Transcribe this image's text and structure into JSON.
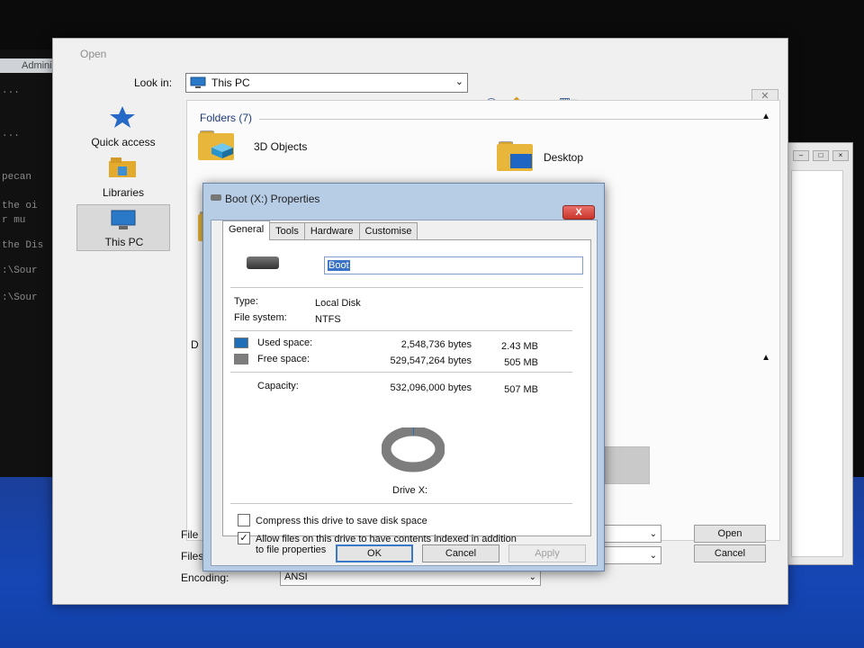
{
  "console": {
    "title": "Administ",
    "lines": [
      "...",
      "...",
      "",
      "pecan",
      "the oi",
      "r mu",
      "",
      "the Dis",
      ":\\Sour",
      "",
      ":\\Sour"
    ]
  },
  "open_dialog": {
    "title": "Open",
    "look_in_label": "Look in:",
    "look_in_value": "This PC",
    "places": [
      {
        "label": "Quick access",
        "icon": "star-icon"
      },
      {
        "label": "Libraries",
        "icon": "libraries-icon"
      },
      {
        "label": "This PC",
        "icon": "computer-icon",
        "selected": true
      }
    ],
    "folders_header": "Folders (7)",
    "folders": [
      {
        "label": "3D Objects"
      },
      {
        "label": "Desktop"
      }
    ],
    "devices_header_partial": "D",
    "file_name_label": "File",
    "files_type_label": "Files",
    "encoding_label": "Encoding:",
    "encoding_value": "ANSI",
    "open_button": "Open",
    "cancel_button": "Cancel"
  },
  "properties_dialog": {
    "title": "Boot (X:) Properties",
    "close_label": "X",
    "tabs": [
      "General",
      "Tools",
      "Hardware",
      "Customise"
    ],
    "active_tab": "General",
    "drive_name": "Boot",
    "type_label": "Type:",
    "type_value": "Local Disk",
    "fs_label": "File system:",
    "fs_value": "NTFS",
    "used_label": "Used space:",
    "used_bytes": "2,548,736 bytes",
    "used_size": "2.43 MB",
    "free_label": "Free space:",
    "free_bytes": "529,547,264 bytes",
    "free_size": "505 MB",
    "capacity_label": "Capacity:",
    "capacity_bytes": "532,096,000 bytes",
    "capacity_size": "507 MB",
    "used_fraction": 0.0048,
    "drive_caption": "Drive X:",
    "compress_label": "Compress this drive to save disk space",
    "compress_checked": false,
    "index_label_line1": "Allow files on this drive to have contents indexed in addition",
    "index_label_line2": "to file properties",
    "index_checked": true,
    "ok_button": "OK",
    "cancel_button": "Cancel",
    "apply_button": "Apply",
    "colors": {
      "used": "#1f6fb8",
      "free": "#7d7d7d",
      "titlebar": "#b7cde6",
      "close": "#c8352b"
    }
  }
}
